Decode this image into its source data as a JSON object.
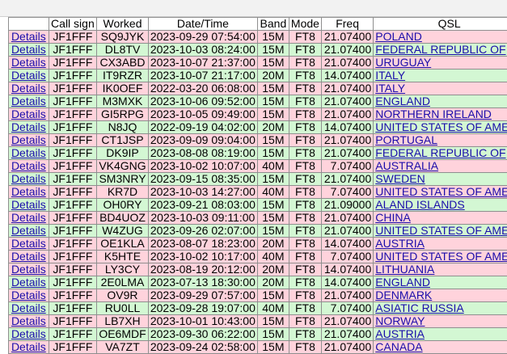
{
  "headers": [
    "",
    "Call sign",
    "Worked",
    "Date/Time",
    "Band",
    "Mode",
    "Freq",
    "QSL"
  ],
  "details_label": "Details",
  "colors": {
    "pink_row": "#ffd3dc",
    "green_row": "#d3f7d3",
    "link": "#1a0dab"
  },
  "rows": [
    {
      "tone": "pink",
      "call": "JF1FFF",
      "worked": "SQ9JYK",
      "datetime": "2023-09-29 07:54:00",
      "band": "15M",
      "mode": "FT8",
      "freq": "21.07400",
      "qsl": "POLAND"
    },
    {
      "tone": "green",
      "call": "JF1FFF",
      "worked": "DL8TV",
      "datetime": "2023-10-03 08:24:00",
      "band": "15M",
      "mode": "FT8",
      "freq": "21.07400",
      "qsl": "FEDERAL REPUBLIC OF"
    },
    {
      "tone": "pink",
      "call": "JF1FFF",
      "worked": "CX3ABD",
      "datetime": "2023-10-07 21:37:00",
      "band": "15M",
      "mode": "FT8",
      "freq": "21.07400",
      "qsl": "URUGUAY"
    },
    {
      "tone": "green",
      "call": "JF1FFF",
      "worked": "IT9RZR",
      "datetime": "2023-10-07 21:17:00",
      "band": "20M",
      "mode": "FT8",
      "freq": "14.07400",
      "qsl": "ITALY"
    },
    {
      "tone": "pink",
      "call": "JF1FFF",
      "worked": "IK0OEF",
      "datetime": "2022-03-20 06:08:00",
      "band": "15M",
      "mode": "FT8",
      "freq": "21.07400",
      "qsl": "ITALY"
    },
    {
      "tone": "green",
      "call": "JF1FFF",
      "worked": "M3MXK",
      "datetime": "2023-10-06 09:52:00",
      "band": "15M",
      "mode": "FT8",
      "freq": "21.07400",
      "qsl": "ENGLAND"
    },
    {
      "tone": "pink",
      "call": "JF1FFF",
      "worked": "GI5RPG",
      "datetime": "2023-10-05 09:49:00",
      "band": "15M",
      "mode": "FT8",
      "freq": "21.07400",
      "qsl": "NORTHERN IRELAND"
    },
    {
      "tone": "green",
      "call": "JF1FFF",
      "worked": "N8JQ",
      "datetime": "2022-09-19 04:02:00",
      "band": "20M",
      "mode": "FT8",
      "freq": "14.07400",
      "qsl": "UNITED STATES OF AME"
    },
    {
      "tone": "pink",
      "call": "JF1FFF",
      "worked": "CT1JSP",
      "datetime": "2023-09-09 09:04:00",
      "band": "15M",
      "mode": "FT8",
      "freq": "21.07400",
      "qsl": "PORTUGAL"
    },
    {
      "tone": "green",
      "call": "JF1FFF",
      "worked": "DK9IP",
      "datetime": "2023-08-08 08:19:00",
      "band": "15M",
      "mode": "FT8",
      "freq": "21.07400",
      "qsl": "FEDERAL REPUBLIC OF"
    },
    {
      "tone": "pink",
      "call": "JF1FFF",
      "worked": "VK4GNG",
      "datetime": "2023-10-02 10:07:00",
      "band": "40M",
      "mode": "FT8",
      "freq": "7.07400",
      "qsl": "AUSTRALIA"
    },
    {
      "tone": "green",
      "call": "JF1FFF",
      "worked": "SM3NRY",
      "datetime": "2023-09-15 08:35:00",
      "band": "15M",
      "mode": "FT8",
      "freq": "21.07400",
      "qsl": "SWEDEN"
    },
    {
      "tone": "pink",
      "call": "JF1FFF",
      "worked": "KR7D",
      "datetime": "2023-10-03 14:27:00",
      "band": "40M",
      "mode": "FT8",
      "freq": "7.07400",
      "qsl": "UNITED STATES OF AME"
    },
    {
      "tone": "green",
      "call": "JF1FFF",
      "worked": "OH0RY",
      "datetime": "2023-09-21 08:03:00",
      "band": "15M",
      "mode": "FT8",
      "freq": "21.09000",
      "qsl": "ALAND ISLANDS"
    },
    {
      "tone": "pink",
      "call": "JF1FFF",
      "worked": "BD4UOZ",
      "datetime": "2023-10-03 09:11:00",
      "band": "15M",
      "mode": "FT8",
      "freq": "21.07400",
      "qsl": "CHINA"
    },
    {
      "tone": "green",
      "call": "JF1FFF",
      "worked": "W4ZUG",
      "datetime": "2023-09-26 02:07:00",
      "band": "15M",
      "mode": "FT8",
      "freq": "21.07400",
      "qsl": "UNITED STATES OF AME"
    },
    {
      "tone": "pink",
      "call": "JF1FFF",
      "worked": "OE1KLA",
      "datetime": "2023-08-07 18:23:00",
      "band": "20M",
      "mode": "FT8",
      "freq": "14.07400",
      "qsl": "AUSTRIA"
    },
    {
      "tone": "pink",
      "call": "JF1FFF",
      "worked": "K5HTE",
      "datetime": "2023-10-02 10:17:00",
      "band": "40M",
      "mode": "FT8",
      "freq": "7.07400",
      "qsl": "UNITED STATES OF AME"
    },
    {
      "tone": "pink",
      "call": "JF1FFF",
      "worked": "LY3CY",
      "datetime": "2023-08-19 20:12:00",
      "band": "20M",
      "mode": "FT8",
      "freq": "14.07400",
      "qsl": "LITHUANIA"
    },
    {
      "tone": "green",
      "call": "JF1FFF",
      "worked": "2E0LMA",
      "datetime": "2023-07-13 18:30:00",
      "band": "20M",
      "mode": "FT8",
      "freq": "14.07400",
      "qsl": "ENGLAND"
    },
    {
      "tone": "pink",
      "call": "JF1FFF",
      "worked": "OV9R",
      "datetime": "2023-09-29 07:57:00",
      "band": "15M",
      "mode": "FT8",
      "freq": "21.07400",
      "qsl": "DENMARK"
    },
    {
      "tone": "green",
      "call": "JF1FFF",
      "worked": "RU0LL",
      "datetime": "2023-09-28 19:07:00",
      "band": "40M",
      "mode": "FT8",
      "freq": "7.07400",
      "qsl": "ASIATIC RUSSIA"
    },
    {
      "tone": "pink",
      "call": "JF1FFF",
      "worked": "LB7XH",
      "datetime": "2023-10-01 10:43:00",
      "band": "15M",
      "mode": "FT8",
      "freq": "21.07400",
      "qsl": "NORWAY"
    },
    {
      "tone": "green",
      "call": "JF1FFF",
      "worked": "OE6MDF",
      "datetime": "2023-09-30 06:22:00",
      "band": "15M",
      "mode": "FT8",
      "freq": "21.07400",
      "qsl": "AUSTRIA"
    },
    {
      "tone": "pink",
      "call": "JF1FFF",
      "worked": "VA7ZT",
      "datetime": "2023-09-24 02:58:00",
      "band": "15M",
      "mode": "FT8",
      "freq": "21.07400",
      "qsl": "CANADA"
    }
  ]
}
